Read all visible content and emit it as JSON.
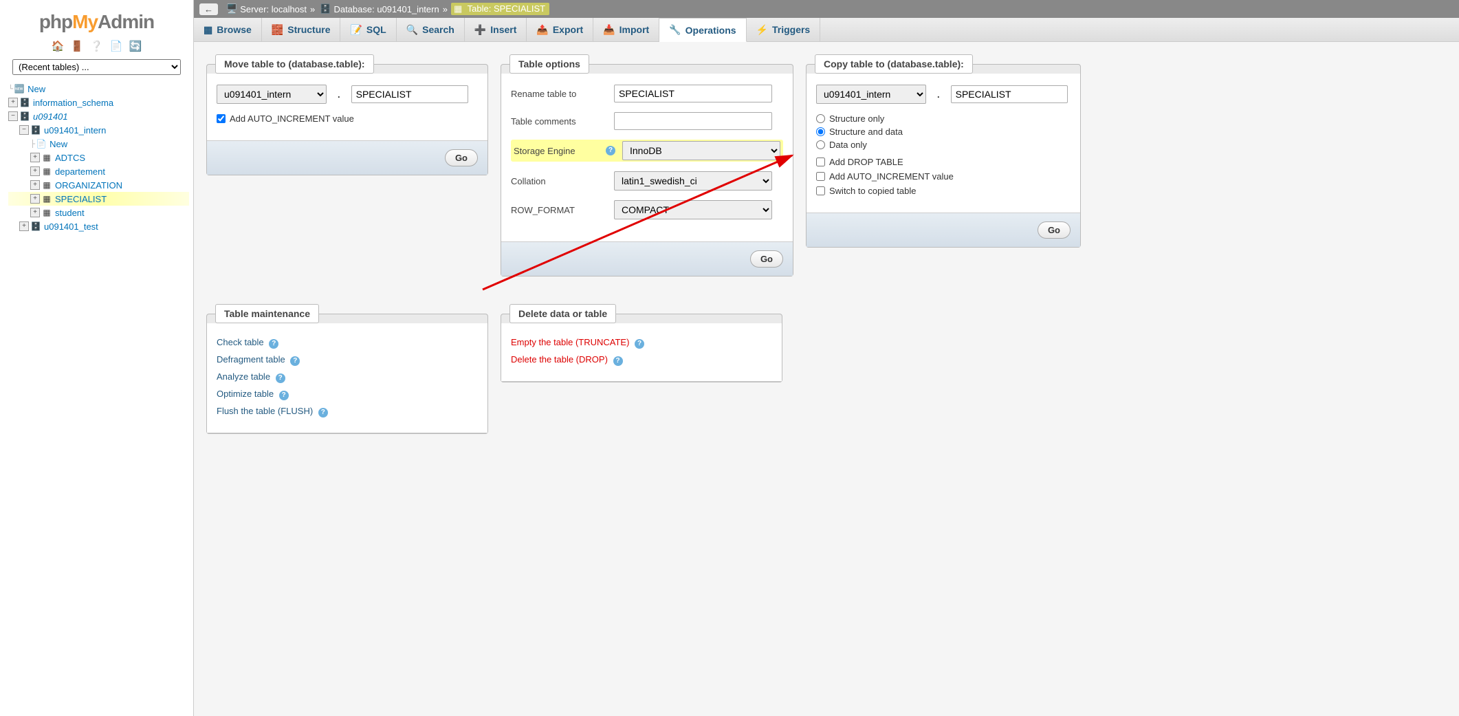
{
  "logo": {
    "php": "php",
    "my": "My",
    "admin": "Admin"
  },
  "sidebar": {
    "recent_placeholder": "(Recent tables) ...",
    "tree": {
      "new": "New",
      "info_schema": "information_schema",
      "db": "u091401",
      "db_intern": "u091401_intern",
      "tbl_new": "New",
      "tbl_adtcs": "ADTCS",
      "tbl_dept": "departement",
      "tbl_org": "ORGANIZATION",
      "tbl_spec": "SPECIALIST",
      "tbl_student": "student",
      "db_test": "u091401_test"
    }
  },
  "breadcrumb": {
    "server_label": "Server:",
    "server_val": "localhost",
    "db_label": "Database:",
    "db_val": "u091401_intern",
    "tbl_label": "Table:",
    "tbl_val": "SPECIALIST"
  },
  "tabs": {
    "browse": "Browse",
    "structure": "Structure",
    "sql": "SQL",
    "search": "Search",
    "insert": "Insert",
    "export": "Export",
    "import": "Import",
    "operations": "Operations",
    "triggers": "Triggers"
  },
  "move": {
    "legend": "Move table to (database.table):",
    "db": "u091401_intern",
    "table": "SPECIALIST",
    "auto_inc": "Add AUTO_INCREMENT value",
    "go": "Go"
  },
  "opts": {
    "legend": "Table options",
    "rename_label": "Rename table to",
    "rename_val": "SPECIALIST",
    "comments_label": "Table comments",
    "comments_val": "",
    "engine_label": "Storage Engine",
    "engine_val": "InnoDB",
    "collation_label": "Collation",
    "collation_val": "latin1_swedish_ci",
    "rowfmt_label": "ROW_FORMAT",
    "rowfmt_val": "COMPACT",
    "go": "Go"
  },
  "copy": {
    "legend": "Copy table to (database.table):",
    "db": "u091401_intern",
    "table": "SPECIALIST",
    "opt_structure_only": "Structure only",
    "opt_structure_data": "Structure and data",
    "opt_data_only": "Data only",
    "chk_drop": "Add DROP TABLE",
    "chk_auto_inc": "Add AUTO_INCREMENT value",
    "chk_switch": "Switch to copied table",
    "go": "Go"
  },
  "maint": {
    "legend": "Table maintenance",
    "check": "Check table",
    "defrag": "Defragment table",
    "analyze": "Analyze table",
    "optimize": "Optimize table",
    "flush": "Flush the table (FLUSH)"
  },
  "del": {
    "legend": "Delete data or table",
    "truncate": "Empty the table (TRUNCATE)",
    "drop": "Delete the table (DROP)"
  }
}
